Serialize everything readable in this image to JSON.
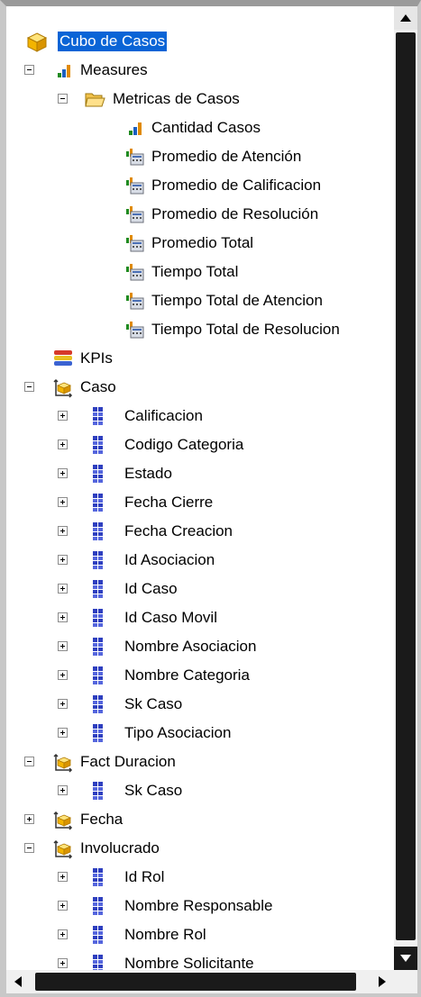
{
  "tree": {
    "cube": {
      "label": "Cubo de Casos"
    },
    "measures": {
      "label": "Measures",
      "group": {
        "label": "Metricas de Casos",
        "items": [
          "Cantidad Casos",
          "Promedio de Atención",
          "Promedio de Calificacion",
          "Promedio de Resolución",
          "Promedio Total",
          "Tiempo Total",
          "Tiempo Total de Atencion",
          "Tiempo Total de Resolucion"
        ]
      }
    },
    "kpis": {
      "label": "KPIs"
    },
    "caso": {
      "label": "Caso",
      "attributes": [
        "Calificacion",
        "Codigo Categoria",
        "Estado",
        "Fecha Cierre",
        "Fecha Creacion",
        "Id Asociacion",
        "Id Caso",
        "Id Caso Movil",
        "Nombre Asociacion",
        "Nombre Categoria",
        "Sk Caso",
        "Tipo Asociacion"
      ]
    },
    "fact_duracion": {
      "label": "Fact Duracion",
      "attributes": [
        "Sk Caso"
      ]
    },
    "fecha": {
      "label": "Fecha"
    },
    "involucrado": {
      "label": "Involucrado",
      "attributes": [
        "Id Rol",
        "Nombre Responsable",
        "Nombre Rol",
        "Nombre Solicitante"
      ]
    }
  },
  "colors": {
    "selection": "#0a64d6",
    "scroll_thumb": "#1a1a1a"
  }
}
